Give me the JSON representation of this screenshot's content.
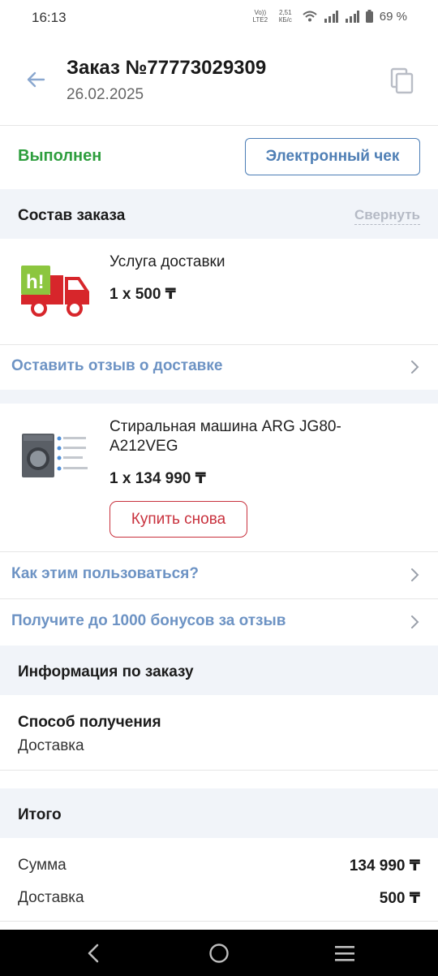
{
  "status_bar": {
    "time": "16:13",
    "volte": "Vo)) LTE2",
    "speed_value": "2,51",
    "speed_unit": "КБ/с",
    "battery": "69 %"
  },
  "header": {
    "title": "Заказ №77773029309",
    "date": "26.02.2025"
  },
  "order_status": {
    "status": "Выполнен",
    "receipt_button": "Электронный чек"
  },
  "composition": {
    "title": "Состав заказа",
    "collapse": "Свернуть",
    "items": [
      {
        "name": "Услуга доставки",
        "qty": "1 x 500 ₸"
      },
      {
        "name": "Стиральная машина ARG JG80-A212VEG",
        "qty": "1 x 134 990 ₸",
        "buy_again": "Купить снова"
      }
    ],
    "delivery_review_link": "Оставить отзыв о доставке",
    "how_to_use_link": "Как этим пользоваться?",
    "bonus_link": "Получите до 1000 бонусов за отзыв"
  },
  "info": {
    "title": "Информация по заказу",
    "method_label": "Способ получения",
    "method_value": "Доставка"
  },
  "total": {
    "title": "Итого",
    "sum_label": "Сумма",
    "sum_value": "134 990 ₸",
    "delivery_label": "Доставка",
    "delivery_value": "500 ₸"
  },
  "colors": {
    "accent_blue": "#4f7fb5",
    "success_green": "#2e9e3e",
    "buy_red": "#c8313d",
    "section_bg": "#f1f4f9"
  },
  "icons": [
    "back-arrow-icon",
    "copy-icon",
    "delivery-truck-logo",
    "washing-machine-image",
    "chevron-right-icon",
    "nav-back-icon",
    "nav-home-icon",
    "nav-menu-icon"
  ]
}
